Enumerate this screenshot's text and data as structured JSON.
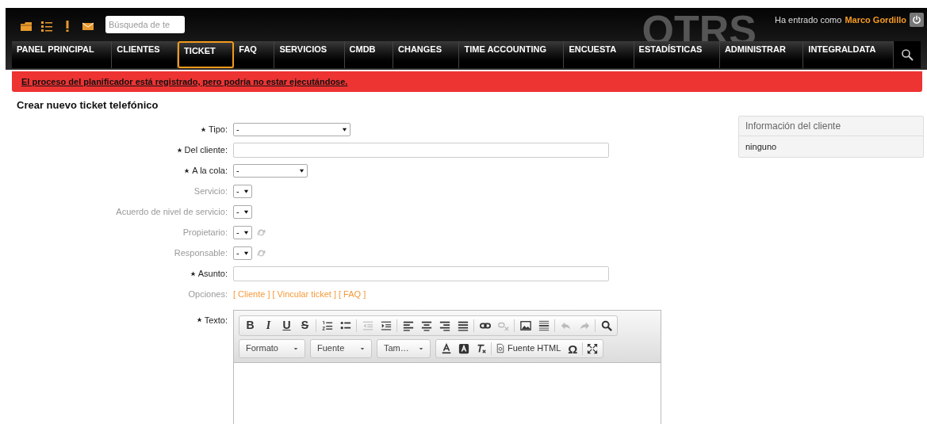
{
  "header": {
    "logo": "OTRS",
    "search": {
      "placeholder": "Búsqueda de te"
    },
    "login_prefix": "Ha entrado como",
    "user": "Marco Gordillo"
  },
  "nav": [
    {
      "label": "PANEL PRINCIPAL",
      "selected": false
    },
    {
      "label": "CLIENTES",
      "selected": false
    },
    {
      "label": "TICKET",
      "selected": true
    },
    {
      "label": "FAQ",
      "selected": false
    },
    {
      "label": "SERVICIOS",
      "selected": false
    },
    {
      "label": "CMDB",
      "selected": false
    },
    {
      "label": "CHANGES",
      "selected": false
    },
    {
      "label": "TIME ACCOUNTING",
      "selected": false
    },
    {
      "label": "ENCUESTA",
      "selected": false
    },
    {
      "label": "ESTADÍSTICAS",
      "selected": false
    },
    {
      "label": "ADMINISTRAR",
      "selected": false
    },
    {
      "label": "INTEGRALDATA",
      "selected": false
    }
  ],
  "alert": "El proceso del planificador está registrado, pero podría no estar ejecutándose.",
  "page_title": "Crear nuevo ticket telefónico",
  "form": [
    {
      "label": "Tipo:",
      "kind": "select",
      "required": true,
      "disabled": false,
      "value": "-"
    },
    {
      "label": "Del cliente:",
      "kind": "text",
      "required": true,
      "disabled": false
    },
    {
      "label": "A la cola:",
      "kind": "select",
      "required": true,
      "disabled": false,
      "value": "-"
    },
    {
      "label": "Servicio:",
      "kind": "select",
      "required": false,
      "disabled": true,
      "value": "-"
    },
    {
      "label": "Acuerdo de nivel de servicio:",
      "kind": "select",
      "required": false,
      "disabled": true,
      "value": "-"
    },
    {
      "label": "Propietario:",
      "kind": "select-refresh",
      "required": false,
      "disabled": true,
      "value": "-"
    },
    {
      "label": "Responsable:",
      "kind": "select-refresh",
      "required": false,
      "disabled": true,
      "value": "-"
    },
    {
      "label": "Asunto:",
      "kind": "text",
      "required": true,
      "disabled": false
    },
    {
      "label": "Opciones:",
      "kind": "links",
      "required": false,
      "disabled": true,
      "links": [
        "[ Cliente ]",
        "[ Vincular ticket ]",
        "[ FAQ ]"
      ]
    },
    {
      "label": "Texto:",
      "kind": "editor",
      "required": true,
      "disabled": false
    }
  ],
  "editor": {
    "toolbar_1": [
      [
        {
          "kind": "bold",
          "label": "B",
          "disabled": false
        },
        {
          "kind": "italic",
          "label": "I",
          "disabled": false
        },
        {
          "kind": "underline",
          "label": "U",
          "disabled": false
        },
        {
          "kind": "strike",
          "label": "S",
          "disabled": false
        }
      ],
      [
        {
          "kind": "numbered-list",
          "disabled": false
        },
        {
          "kind": "bullet-list",
          "disabled": false
        }
      ],
      [
        {
          "kind": "outdent",
          "disabled": true
        },
        {
          "kind": "indent",
          "disabled": false
        }
      ],
      [
        {
          "kind": "align-left",
          "disabled": false
        },
        {
          "kind": "align-center",
          "disabled": false
        },
        {
          "kind": "align-right",
          "disabled": false
        },
        {
          "kind": "justify",
          "disabled": false
        }
      ],
      [
        {
          "kind": "link",
          "disabled": false
        },
        {
          "kind": "unlink",
          "disabled": true
        }
      ],
      [
        {
          "kind": "image",
          "disabled": false
        },
        {
          "kind": "horizontal-rule",
          "disabled": false
        }
      ],
      [
        {
          "kind": "undo",
          "disabled": true
        },
        {
          "kind": "redo",
          "disabled": true
        }
      ],
      [
        {
          "kind": "search",
          "disabled": false
        }
      ]
    ],
    "dropdowns": [
      "Formato",
      "Fuente",
      "Tam…"
    ],
    "source_button": "Fuente HTML",
    "special_char": "Ω"
  },
  "sidebar": {
    "title": "Información del cliente",
    "value": "ninguno"
  }
}
